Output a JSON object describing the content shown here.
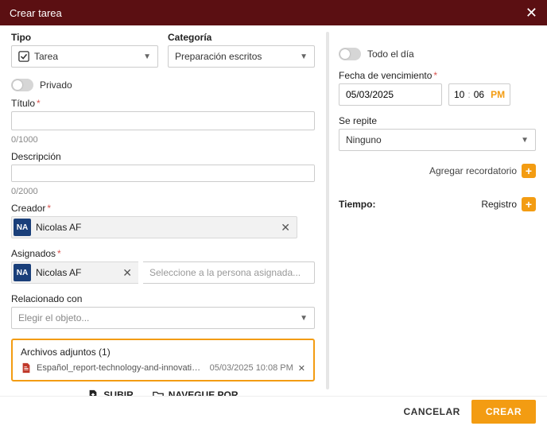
{
  "header": {
    "title": "Crear tarea"
  },
  "left": {
    "type_label": "Tipo",
    "type_value": "Tarea",
    "category_label": "Categoría",
    "category_value": "Preparación escritos",
    "private_label": "Privado",
    "title_label": "Título",
    "title_counter": "0/1000",
    "desc_label": "Descripción",
    "desc_counter": "0/2000",
    "creator_label": "Creador",
    "creator": {
      "initials": "NA",
      "name": "Nicolas AF"
    },
    "assignees_label": "Asignados",
    "assignee": {
      "initials": "NA",
      "name": "Nicolas AF"
    },
    "assignee_placeholder": "Seleccione a la persona asignada...",
    "related_label": "Relacionado con",
    "related_placeholder": "Elegir el objeto...",
    "attachments_label": "Archivos adjuntos (1)",
    "attachment": {
      "name": "Español_report-technology-and-innovation-in-l...",
      "date": "05/03/2025 10:08 PM"
    },
    "upload_label": "SUBIR",
    "browse_label": "NAVEGUE POR"
  },
  "right": {
    "allday_label": "Todo el día",
    "due_label": "Fecha de vencimiento",
    "due_date": "05/03/2025",
    "due_hour": "10",
    "due_min": "06",
    "due_ampm": "PM",
    "repeat_label": "Se repite",
    "repeat_value": "Ninguno",
    "reminder_label": "Agregar recordatorio",
    "time_label": "Tiempo:",
    "log_label": "Registro"
  },
  "footer": {
    "cancel": "CANCELAR",
    "create": "CREAR"
  }
}
